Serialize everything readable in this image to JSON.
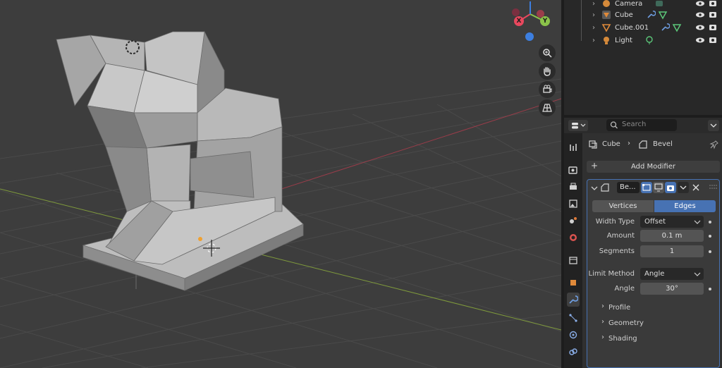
{
  "outliner": {
    "rows": [
      {
        "name": "Camera",
        "icon": "camera-object-icon"
      },
      {
        "name": "Cube",
        "icon": "mesh-object-icon"
      },
      {
        "name": "Cube.001",
        "icon": "mesh-object-icon"
      },
      {
        "name": "Light",
        "icon": "light-object-icon"
      }
    ]
  },
  "properties": {
    "search_placeholder": "Search",
    "breadcrumb": {
      "object": "Cube",
      "modifier": "Bevel"
    },
    "add_modifier_label": "Add Modifier",
    "modifier": {
      "name": "Be...",
      "affect_tabs": [
        "Vertices",
        "Edges"
      ],
      "affect_selected": "Edges",
      "width_type_label": "Width Type",
      "width_type_value": "Offset",
      "amount_label": "Amount",
      "amount_value": "0.1 m",
      "segments_label": "Segments",
      "segments_value": "1",
      "limit_method_label": "Limit Method",
      "limit_method_value": "Angle",
      "angle_label": "Angle",
      "angle_value": "30°",
      "subpanels": [
        "Profile",
        "Geometry",
        "Shading"
      ]
    }
  },
  "gizmo": {
    "x": "X",
    "y": "Y"
  },
  "colors": {
    "accent": "#4772b3",
    "x_axis": "#e8485e",
    "y_axis": "#8bc34a",
    "z_axis": "#3d7fe0"
  }
}
